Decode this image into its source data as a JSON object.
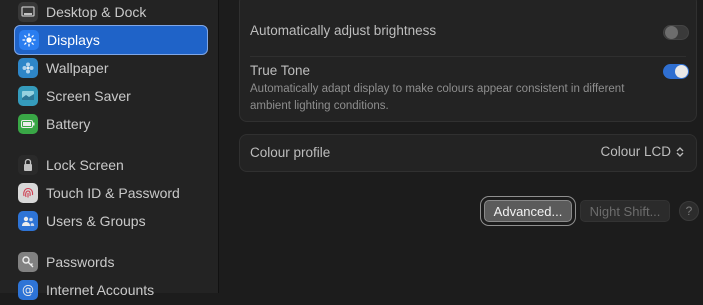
{
  "sidebar": {
    "items": [
      {
        "label": "Desktop & Dock",
        "icon": "desktop-dock-icon",
        "color": "#3a3a3a"
      },
      {
        "label": "Displays",
        "icon": "sun-icon",
        "color": "#2a7df0",
        "selected": true
      },
      {
        "label": "Wallpaper",
        "icon": "wallpaper-icon",
        "color": "#2f8fd6"
      },
      {
        "label": "Screen Saver",
        "icon": "screen-saver-icon",
        "color": "#37a6c9"
      },
      {
        "label": "Battery",
        "icon": "battery-icon",
        "color": "#3bb34a"
      },
      {
        "label": "Lock Screen",
        "icon": "lock-icon",
        "color": "#2b2b2b"
      },
      {
        "label": "Touch ID & Password",
        "icon": "fingerprint-icon",
        "color": "#e8e8e8"
      },
      {
        "label": "Users & Groups",
        "icon": "users-icon",
        "color": "#2f7be6"
      },
      {
        "label": "Passwords",
        "icon": "key-icon",
        "color": "#8a8a8a"
      },
      {
        "label": "Internet Accounts",
        "icon": "at-icon",
        "color": "#2f7be6"
      }
    ]
  },
  "main": {
    "auto_brightness": {
      "label": "Automatically adjust brightness",
      "enabled": false
    },
    "true_tone": {
      "label": "True Tone",
      "description_line1": "Automatically adapt display to make colours appear consistent in different",
      "description_line2": "ambient lighting conditions.",
      "enabled": true
    },
    "colour_profile": {
      "label": "Colour profile",
      "value": "Colour LCD",
      "stepper_glyph": "⌃⌄"
    },
    "buttons": {
      "advanced": "Advanced...",
      "night_shift": "Night Shift...",
      "help": "?"
    }
  },
  "colors": {
    "accent": "#1f63c8",
    "toggle_on": "#2f6fd1"
  }
}
